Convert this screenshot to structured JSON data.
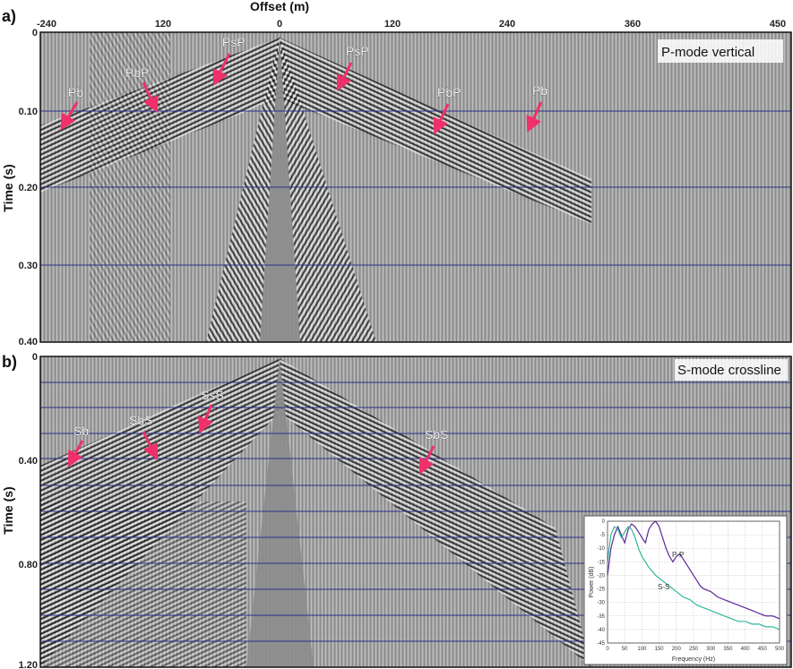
{
  "figure": {
    "top_axis_title": "Offset (m)",
    "top_ticks": [
      "-240",
      "120",
      "0",
      "120",
      "240",
      "360",
      "450"
    ],
    "panel_a": {
      "label": "a)",
      "mode_label": "P-mode vertical",
      "y_axis_title": "Time (s)",
      "y_ticks": [
        "0",
        "0.10",
        "0.20",
        "0.30",
        "0.40"
      ],
      "events": [
        "Pb",
        "PbP",
        "PsP",
        "PsP",
        "PbP",
        "Pb"
      ]
    },
    "panel_b": {
      "label": "b)",
      "mode_label": "S-mode crossline",
      "y_axis_title": "Time (s)",
      "y_ticks": [
        "0",
        "0.40",
        "0.80",
        "1.20"
      ],
      "events": [
        "Sb",
        "SbS",
        "SsS",
        "SbS"
      ]
    },
    "colors": {
      "arrow": "#f0306a",
      "gridline": "#2a2f8a",
      "pp_curve": "#5a2a9a",
      "ss_curve": "#2fb89a"
    }
  },
  "chart_data": {
    "type": "line",
    "title": "",
    "xlabel": "Frequency (Hz)",
    "ylabel": "Power (dB)",
    "xlim": [
      0,
      500
    ],
    "ylim": [
      -45,
      0
    ],
    "x_ticks": [
      "0",
      "50",
      "100",
      "150",
      "200",
      "250",
      "300",
      "350",
      "400",
      "450",
      "500"
    ],
    "y_ticks": [
      "0",
      "-5",
      "-10",
      "-15",
      "-20",
      "-25",
      "-30",
      "-35",
      "-40",
      "-45"
    ],
    "grid": true,
    "series": [
      {
        "name": "P-P",
        "x": [
          0,
          10,
          20,
          30,
          40,
          50,
          60,
          70,
          80,
          90,
          100,
          110,
          120,
          130,
          140,
          150,
          160,
          170,
          180,
          190,
          200,
          210,
          220,
          230,
          240,
          250,
          260,
          270,
          280,
          300,
          320,
          340,
          360,
          380,
          400,
          420,
          440,
          460,
          480,
          500
        ],
        "y": [
          -20,
          -10,
          -5,
          -2,
          -5,
          -8,
          -3,
          -1,
          -2,
          -4,
          -6,
          -8,
          -3,
          -1,
          0,
          -2,
          -6,
          -10,
          -13,
          -15,
          -13,
          -12,
          -14,
          -16,
          -18,
          -20,
          -22,
          -24,
          -25,
          -26,
          -28,
          -29,
          -30,
          -31,
          -32,
          -33,
          -34,
          -35,
          -35,
          -36
        ]
      },
      {
        "name": "S-S",
        "x": [
          0,
          10,
          20,
          30,
          40,
          50,
          60,
          70,
          80,
          90,
          100,
          110,
          120,
          140,
          160,
          180,
          200,
          220,
          240,
          260,
          280,
          300,
          320,
          340,
          360,
          380,
          400,
          420,
          440,
          460,
          480,
          500
        ],
        "y": [
          -15,
          -5,
          -2,
          -3,
          -6,
          -4,
          -2,
          -3,
          -6,
          -10,
          -13,
          -15,
          -17,
          -20,
          -22,
          -24,
          -26,
          -28,
          -29,
          -31,
          -32,
          -33,
          -34,
          -35,
          -36,
          -37,
          -37,
          -38,
          -38,
          -39,
          -39,
          -40
        ]
      }
    ]
  }
}
